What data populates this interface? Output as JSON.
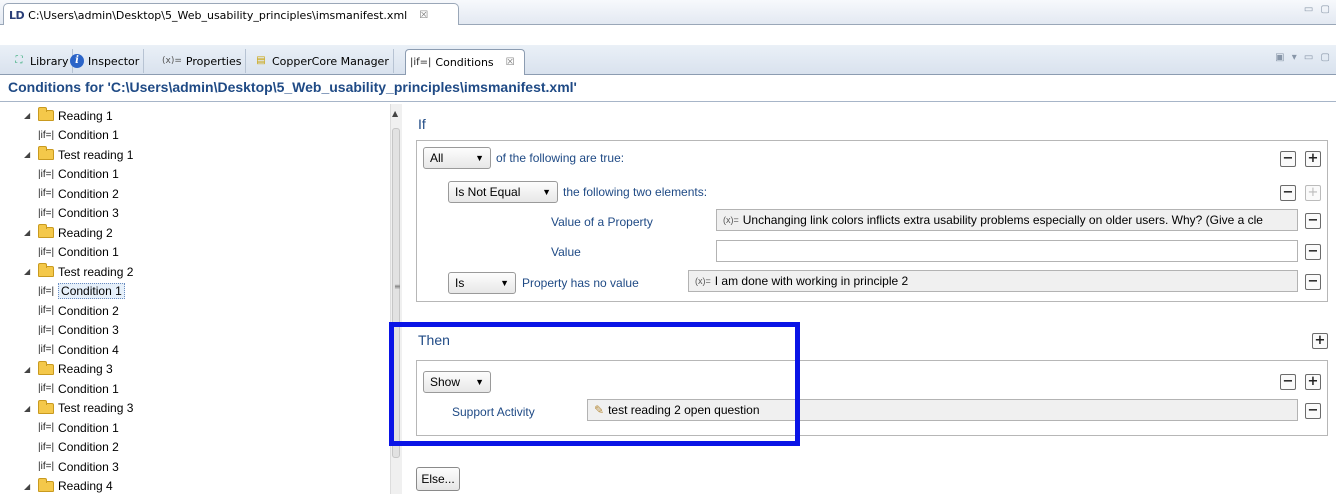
{
  "editor_tab": {
    "app_icon": "LD",
    "title": "C:\\Users\\admin\\Desktop\\5_Web_usability_principles\\imsmanifest.xml",
    "close": "☒"
  },
  "view_tabs": [
    {
      "icon": "library-icon",
      "label": "Library"
    },
    {
      "icon": "info-icon",
      "label": "Inspector"
    },
    {
      "icon": "properties-icon",
      "label": "Properties",
      "glyph": "(x)="
    },
    {
      "icon": "coppercore-icon",
      "label": "CopperCore Manager"
    },
    {
      "icon": "conditions-icon",
      "label": "Conditions",
      "glyph": "|if=|",
      "active": true
    }
  ],
  "page_title": "Conditions for 'C:\\Users\\admin\\Desktop\\5_Web_usability_principles\\imsmanifest.xml'",
  "tree": {
    "cond_glyph": "|if=|",
    "items": [
      {
        "type": "folder",
        "label": "Reading 1"
      },
      {
        "type": "condition",
        "label": "Condition 1"
      },
      {
        "type": "folder",
        "label": "Test reading 1"
      },
      {
        "type": "condition",
        "label": "Condition 1"
      },
      {
        "type": "condition",
        "label": "Condition 2"
      },
      {
        "type": "condition",
        "label": "Condition 3"
      },
      {
        "type": "folder",
        "label": "Reading 2"
      },
      {
        "type": "condition",
        "label": "Condition 1"
      },
      {
        "type": "folder",
        "label": "Test reading 2"
      },
      {
        "type": "condition",
        "label": "Condition 1",
        "selected": true
      },
      {
        "type": "condition",
        "label": "Condition 2"
      },
      {
        "type": "condition",
        "label": "Condition 3"
      },
      {
        "type": "condition",
        "label": "Condition 4"
      },
      {
        "type": "folder",
        "label": "Reading 3"
      },
      {
        "type": "condition",
        "label": "Condition 1"
      },
      {
        "type": "folder",
        "label": "Test reading 3"
      },
      {
        "type": "condition",
        "label": "Condition 1"
      },
      {
        "type": "condition",
        "label": "Condition 2"
      },
      {
        "type": "condition",
        "label": "Condition 3"
      },
      {
        "type": "folder",
        "label": "Reading 4"
      }
    ]
  },
  "if_section": {
    "heading": "If",
    "all_combo": "All",
    "all_text": "of the following are true:",
    "not_equal_combo": "Is Not Equal",
    "not_equal_text": "the following two elements:",
    "value_of_property_label": "Value of a Property",
    "value_of_property_value": "Unchanging link colors inflicts extra usability problems especially on older users. Why? (Give a cle",
    "value_label": "Value",
    "value_value": "",
    "is_combo": "Is",
    "no_value_text": "Property has no value",
    "no_value_property": "I am done with working in principle 2",
    "prop_glyph": "(x)="
  },
  "then_section": {
    "heading": "Then",
    "show_combo": "Show",
    "support_activity_label": "Support Activity",
    "support_activity_value": "test reading 2 open question"
  },
  "else_button": "Else...",
  "buttons": {
    "minus": "−",
    "plus": "+"
  },
  "highlight_color": "#0a14e6"
}
